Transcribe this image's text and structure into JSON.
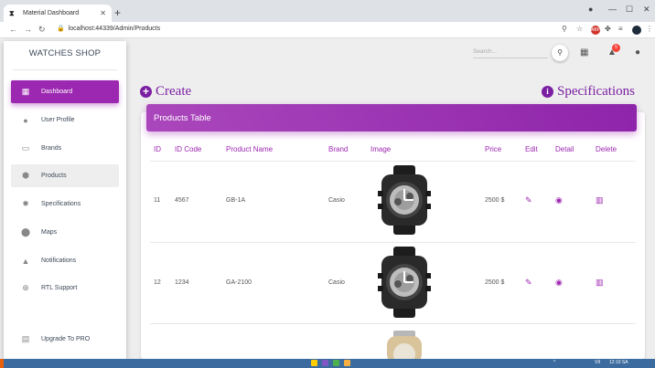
{
  "browser": {
    "tab_title": "Material Dashboard",
    "url": "localhost:44339/Admin/Products"
  },
  "sidebar": {
    "brand": "WATCHES SHOP",
    "items": [
      {
        "label": "Dashboard",
        "icon": "dashboard-icon",
        "state": "active"
      },
      {
        "label": "User Profile",
        "icon": "person-icon"
      },
      {
        "label": "Brands",
        "icon": "clipboard-icon"
      },
      {
        "label": "Products",
        "icon": "cube-icon",
        "state": "hover"
      },
      {
        "label": "Specifications",
        "icon": "gear-icon"
      },
      {
        "label": "Maps",
        "icon": "location-pin-icon"
      },
      {
        "label": "Notifications",
        "icon": "bell-icon"
      },
      {
        "label": "RTL Support",
        "icon": "globe-icon"
      }
    ],
    "upgrade": {
      "label": "Upgrade To PRO",
      "icon": "unarchive-icon"
    }
  },
  "toolbar": {
    "search_placeholder": "Search...",
    "notification_count": "5"
  },
  "page": {
    "create_label": "Create",
    "specifications_label": "Specifications",
    "card_title": "Products Table"
  },
  "table": {
    "headers": [
      "ID",
      "ID Code",
      "Product Name",
      "Brand",
      "Image",
      "Price",
      "Edit",
      "Detail",
      "Delete"
    ],
    "rows": [
      {
        "id": "11",
        "code": "4567",
        "name": "GB-1A",
        "brand": "Casio",
        "price": "2500 $"
      },
      {
        "id": "12",
        "code": "1234",
        "name": "GA-2100",
        "brand": "Casio",
        "price": "2500 $"
      }
    ]
  },
  "taskbar": {
    "lang": "VII",
    "time": "12:10 SA"
  },
  "colors": {
    "accent": "#9c27b0",
    "accent_dark": "#7b1fa2",
    "badge": "#f44336"
  }
}
